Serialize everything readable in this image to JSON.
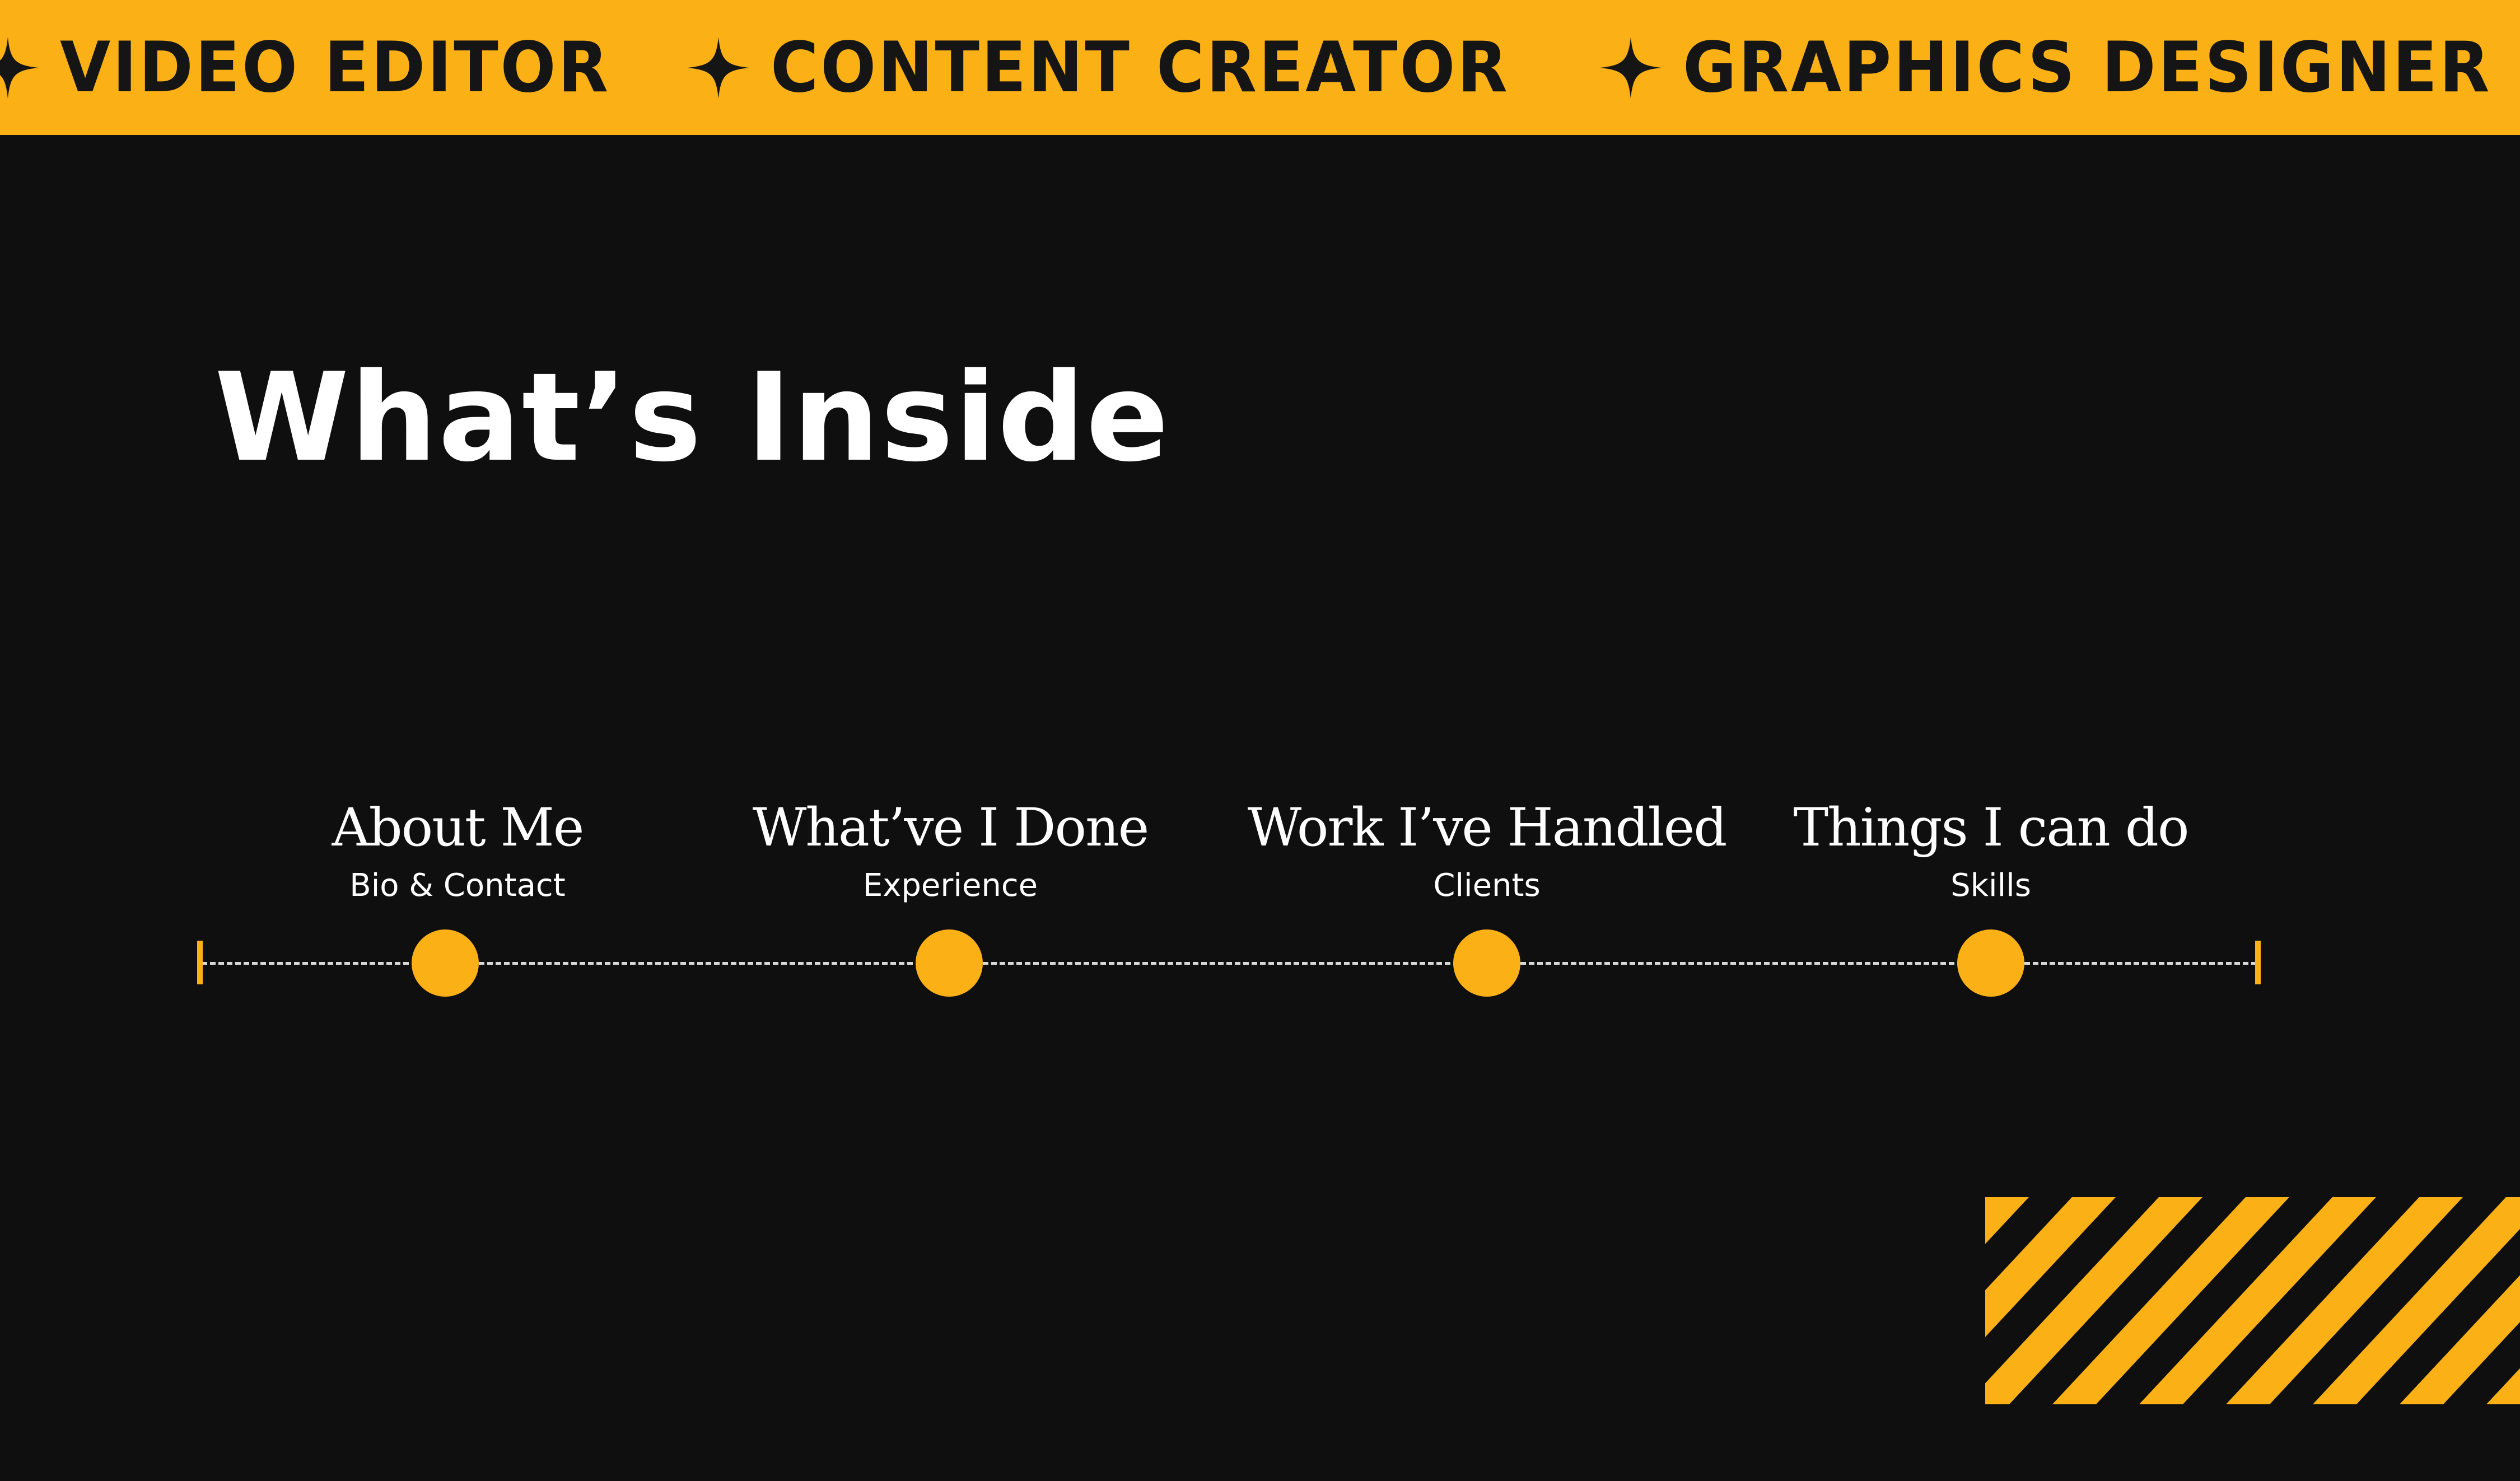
{
  "banner": {
    "items": [
      {
        "icon": "four-point-star-icon",
        "label": "VIDEO EDITOR"
      },
      {
        "icon": "four-point-star-icon",
        "label": "CONTENT CREATOR"
      },
      {
        "icon": "four-point-star-icon",
        "label": "GRAPHICS DESIGNER"
      }
    ]
  },
  "title": "What’s Inside",
  "sections": [
    {
      "heading": "About Me",
      "sub": "Bio & Contact"
    },
    {
      "heading": "What’ve I Done",
      "sub": "Experience"
    },
    {
      "heading": "Work I’ve Handled",
      "sub": "Clients"
    },
    {
      "heading": "Things I can do",
      "sub": "Skills"
    }
  ],
  "colors": {
    "accent": "#fbb116",
    "background": "#0f0f0f",
    "text": "#ffffff",
    "banner_text": "#151515"
  }
}
